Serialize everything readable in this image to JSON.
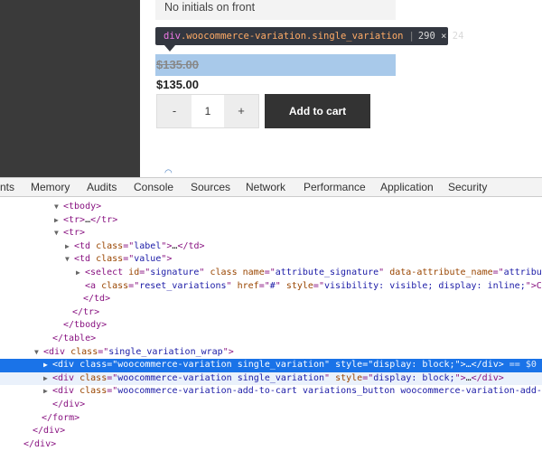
{
  "page": {
    "option_text": "No initials on front",
    "tooltip": {
      "tag": "div",
      "class_text": ".woocommerce-variation.single_variation",
      "separator": "|",
      "dims": "290 × 24"
    },
    "highlight_price": "$135.00",
    "price": "$135.00",
    "qty_minus": "-",
    "qty_value": "1",
    "qty_plus": "+",
    "add_to_cart": "Add to cart"
  },
  "devtools": {
    "tabs": [
      "nts",
      "Memory",
      "Audits",
      "Console",
      "Sources",
      "Network",
      "Performance",
      "Application",
      "Security"
    ],
    "rows": [
      {
        "tri": "▼",
        "parts": [
          [
            "t",
            "<tbody>"
          ]
        ]
      },
      {
        "tri": "▶",
        "parts": [
          [
            "t",
            "<tr>"
          ],
          [
            "x",
            "…"
          ],
          [
            "t",
            "</tr>"
          ]
        ]
      },
      {
        "tri": "▼",
        "parts": [
          [
            "t",
            "<tr>"
          ]
        ]
      },
      {
        "tri": "▶",
        "parts": [
          [
            "t",
            "<td "
          ],
          [
            "a",
            "class"
          ],
          [
            "t",
            "=\""
          ],
          [
            "v",
            "label"
          ],
          [
            "t",
            "\">"
          ],
          [
            "x",
            "…"
          ],
          [
            "t",
            "</td>"
          ]
        ]
      },
      {
        "tri": "▼",
        "parts": [
          [
            "t",
            "<td "
          ],
          [
            "a",
            "class"
          ],
          [
            "t",
            "=\""
          ],
          [
            "v",
            "value"
          ],
          [
            "t",
            "\">"
          ]
        ]
      },
      {
        "tri": "▶",
        "parts": [
          [
            "t",
            "<select "
          ],
          [
            "a",
            "id"
          ],
          [
            "t",
            "=\""
          ],
          [
            "v",
            "signature"
          ],
          [
            "t",
            "\" "
          ],
          [
            "a",
            "class"
          ],
          [
            "t",
            " "
          ],
          [
            "a",
            "name"
          ],
          [
            "t",
            "=\""
          ],
          [
            "v",
            "attribute_signature"
          ],
          [
            "t",
            "\" "
          ],
          [
            "a",
            "data-attribute_name"
          ],
          [
            "t",
            "=\""
          ],
          [
            "v",
            "attribu"
          ]
        ]
      },
      {
        "tri": "",
        "parts": [
          [
            "t",
            "<a "
          ],
          [
            "a",
            "class"
          ],
          [
            "t",
            "=\""
          ],
          [
            "v",
            "reset_variations"
          ],
          [
            "t",
            "\" "
          ],
          [
            "a",
            "href"
          ],
          [
            "t",
            "=\""
          ],
          [
            "v",
            "#"
          ],
          [
            "t",
            "\" "
          ],
          [
            "a",
            "style"
          ],
          [
            "t",
            "=\""
          ],
          [
            "v",
            "visibility: visible; display: inline;"
          ],
          [
            "t",
            "\">C"
          ]
        ]
      },
      {
        "tri": "",
        "parts": [
          [
            "t",
            "</td>"
          ]
        ]
      },
      {
        "tri": "",
        "parts": [
          [
            "t",
            "</tr>"
          ]
        ]
      },
      {
        "tri": "",
        "parts": [
          [
            "t",
            "</tbody>"
          ]
        ]
      },
      {
        "tri": "",
        "parts": [
          [
            "t",
            "</table>"
          ]
        ]
      },
      {
        "tri": "▼",
        "parts": [
          [
            "t",
            "<div "
          ],
          [
            "a",
            "class"
          ],
          [
            "t",
            "=\""
          ],
          [
            "v",
            "single_variation_wrap"
          ],
          [
            "t",
            "\">"
          ]
        ]
      },
      {
        "tri": "▶",
        "parts": [
          [
            "t",
            "<div "
          ],
          [
            "a",
            "class"
          ],
          [
            "t",
            "=\""
          ],
          [
            "v",
            "woocommerce-variation single_variation"
          ],
          [
            "t",
            "\" "
          ],
          [
            "a",
            "style"
          ],
          [
            "t",
            "=\""
          ],
          [
            "v",
            "display: block;"
          ],
          [
            "t",
            "\">"
          ],
          [
            "x",
            "…"
          ],
          [
            "t",
            "</div>"
          ],
          [
            "d",
            " == $0"
          ]
        ]
      },
      {
        "tri": "▶",
        "parts": [
          [
            "t",
            "<div "
          ],
          [
            "a",
            "class"
          ],
          [
            "t",
            "=\""
          ],
          [
            "v",
            "woocommerce-variation single_variation"
          ],
          [
            "t",
            "\" "
          ],
          [
            "a",
            "style"
          ],
          [
            "t",
            "=\""
          ],
          [
            "v",
            "display: block;"
          ],
          [
            "t",
            "\">"
          ],
          [
            "x",
            "…"
          ],
          [
            "t",
            "</div>"
          ]
        ]
      },
      {
        "tri": "▶",
        "parts": [
          [
            "t",
            "<div "
          ],
          [
            "a",
            "class"
          ],
          [
            "t",
            "=\""
          ],
          [
            "v",
            "woocommerce-variation-add-to-cart variations_button woocommerce-variation-add-"
          ]
        ]
      },
      {
        "tri": "",
        "parts": [
          [
            "t",
            "</div>"
          ]
        ]
      },
      {
        "tri": "",
        "parts": [
          [
            "t",
            "</form>"
          ]
        ]
      },
      {
        "tri": "",
        "parts": [
          [
            "t",
            "</div>"
          ]
        ]
      },
      {
        "tri": "",
        "parts": [
          [
            "t",
            "</div>"
          ]
        ]
      }
    ]
  }
}
